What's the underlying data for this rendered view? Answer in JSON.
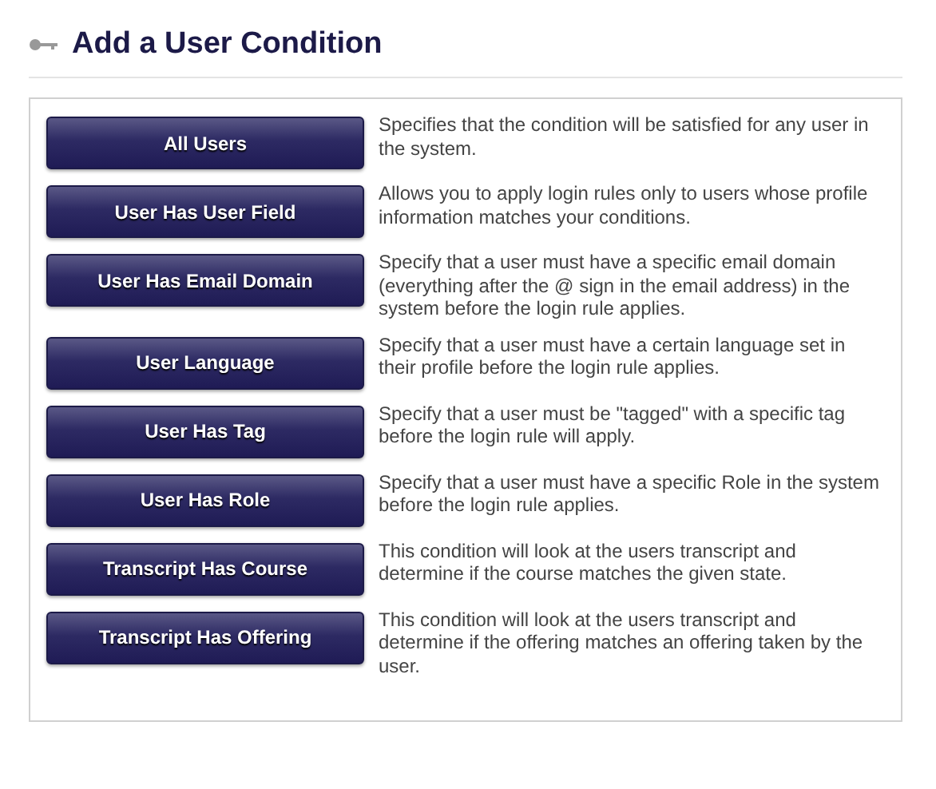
{
  "header": {
    "title": "Add a User Condition"
  },
  "conditions": [
    {
      "button": "All Users",
      "description": "Specifies that the condition will be satisfied for any user in the system."
    },
    {
      "button": "User Has User Field",
      "description": "Allows you to apply login rules only to users whose profile information matches your conditions."
    },
    {
      "button": "User Has Email Domain",
      "description": "Specify that a user must have a specific email domain (everything after the @ sign in the email address) in the system before the login rule applies."
    },
    {
      "button": "User Language",
      "description": "Specify that a user must have a certain language set in their profile before the login rule applies."
    },
    {
      "button": "User Has Tag",
      "description": "Specify that a user must be \"tagged\" with a specific tag before the login rule will apply."
    },
    {
      "button": "User Has Role",
      "description": "Specify that a user must have a specific Role in the system before the login rule applies."
    },
    {
      "button": "Transcript Has Course",
      "description": "This condition will look at the users transcript and determine if the course matches the given state."
    },
    {
      "button": "Transcript Has Offering",
      "description": "This condition will look at the users transcript and determine if the offering matches an offering taken by the user."
    }
  ]
}
